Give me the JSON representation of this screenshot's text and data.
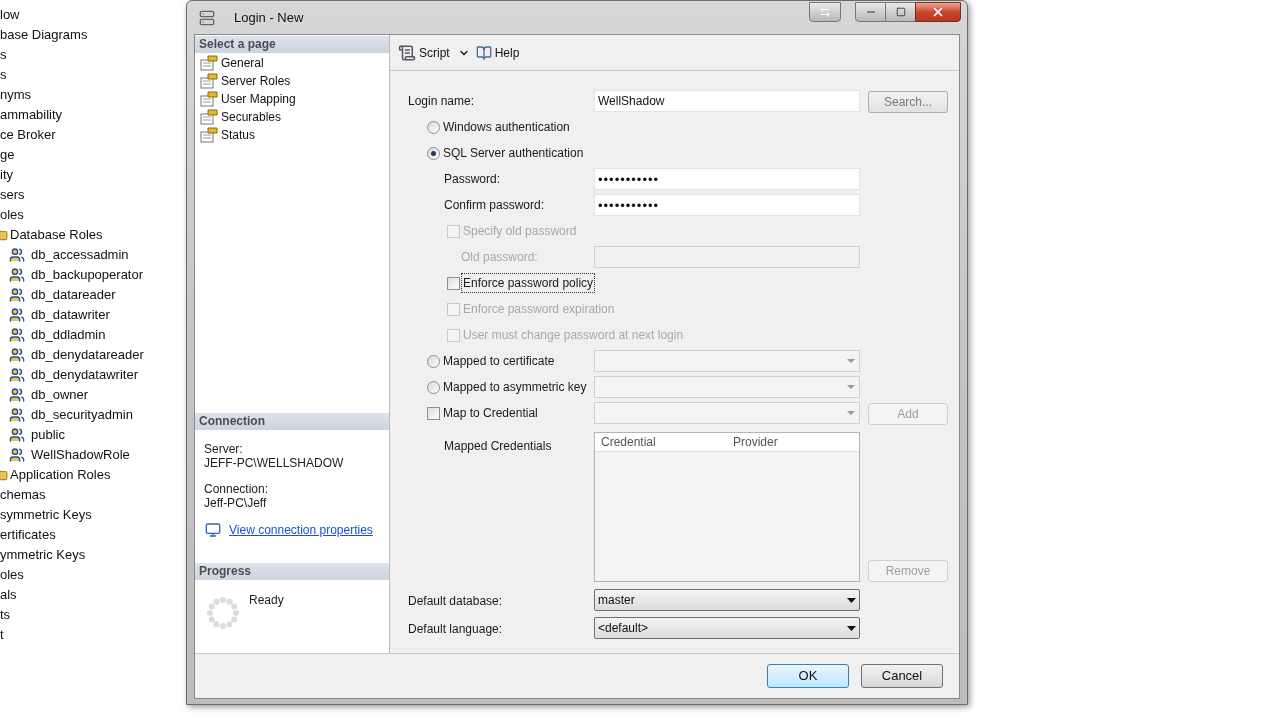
{
  "explorer_tree": [
    {
      "label": "low"
    },
    {
      "label": "base Diagrams"
    },
    {
      "label": "s"
    },
    {
      "label": "s"
    },
    {
      "label": "nyms"
    },
    {
      "label": "ammability"
    },
    {
      "label": "ce Broker"
    },
    {
      "label": "ge"
    },
    {
      "label": "ity"
    },
    {
      "label": "sers"
    },
    {
      "label": "oles",
      "children": [
        {
          "label": "Database Roles",
          "children": [
            {
              "label": "db_accessadmin"
            },
            {
              "label": "db_backupoperator"
            },
            {
              "label": "db_datareader"
            },
            {
              "label": "db_datawriter"
            },
            {
              "label": "db_ddladmin"
            },
            {
              "label": "db_denydatareader"
            },
            {
              "label": "db_denydatawriter"
            },
            {
              "label": "db_owner"
            },
            {
              "label": "db_securityadmin"
            },
            {
              "label": "public"
            },
            {
              "label": "WellShadowRole"
            }
          ]
        },
        {
          "label": "Application Roles"
        }
      ]
    },
    {
      "label": "chemas"
    },
    {
      "label": "symmetric Keys"
    },
    {
      "label": "ertificates"
    },
    {
      "label": "ymmetric Keys"
    },
    {
      "label": "oles"
    },
    {
      "label": "als"
    },
    {
      "label": "ts"
    },
    {
      "label": "t"
    }
  ],
  "window": {
    "title": "Login - New"
  },
  "select_page": {
    "title": "Select a page",
    "items": [
      {
        "label": "General"
      },
      {
        "label": "Server Roles"
      },
      {
        "label": "User Mapping"
      },
      {
        "label": "Securables"
      },
      {
        "label": "Status"
      }
    ]
  },
  "connection": {
    "title": "Connection",
    "server_label": "Server:",
    "server": "JEFF-PC\\WELLSHADOW",
    "connection_label": "Connection:",
    "connection": "Jeff-PC\\Jeff",
    "link": "View connection properties"
  },
  "progress": {
    "title": "Progress",
    "status": "Ready"
  },
  "toolbar": {
    "script": "Script",
    "help": "Help"
  },
  "form": {
    "rows": [
      {
        "kind": "text",
        "label": "Login name:",
        "value": "WellShadow",
        "disabled": false,
        "button": {
          "label": "Search...",
          "disabled": false
        }
      },
      {
        "kind": "radio",
        "label": "Windows authentication",
        "selected": false
      },
      {
        "kind": "radio",
        "label": "SQL Server authentication",
        "selected": true,
        "children": [
          {
            "kind": "password",
            "label": "Password:",
            "value": "•••••••••••"
          },
          {
            "kind": "password",
            "label": "Confirm password:",
            "value": "•••••••••••"
          },
          {
            "kind": "checkbox",
            "label": "Specify old password",
            "checked": false,
            "disabled": true,
            "focused": false,
            "children": [
              {
                "kind": "text",
                "label": "Old password:",
                "disabled": true
              }
            ]
          },
          {
            "kind": "checkbox",
            "label": "Enforce password policy",
            "checked": false,
            "disabled": false,
            "focused": true
          },
          {
            "kind": "checkbox",
            "label": "Enforce password expiration",
            "checked": false,
            "disabled": true,
            "focused": false
          },
          {
            "kind": "checkbox",
            "label": "User must change password at next login",
            "checked": false,
            "disabled": true,
            "focused": false
          }
        ]
      },
      {
        "kind": "radio-combo",
        "label": "Mapped to certificate",
        "selected": false
      },
      {
        "kind": "radio-combo",
        "label": "Mapped to asymmetric key",
        "selected": false
      },
      {
        "kind": "checkbox-combo",
        "label": "Map to Credential",
        "checked": false,
        "disabled": false,
        "focused": false,
        "button": {
          "label": "Add",
          "disabled": true
        }
      }
    ]
  },
  "credentials": {
    "label": "Mapped Credentials",
    "columns": [
      "Credential",
      "Provider"
    ],
    "button": {
      "label": "Remove",
      "disabled": true
    }
  },
  "defaults": [
    {
      "label": "Default database:",
      "value": "master"
    },
    {
      "label": "Default language:",
      "value": "<default>"
    }
  ],
  "buttons": [
    {
      "label": "OK",
      "default": true
    },
    {
      "label": "Cancel",
      "default": false
    }
  ]
}
